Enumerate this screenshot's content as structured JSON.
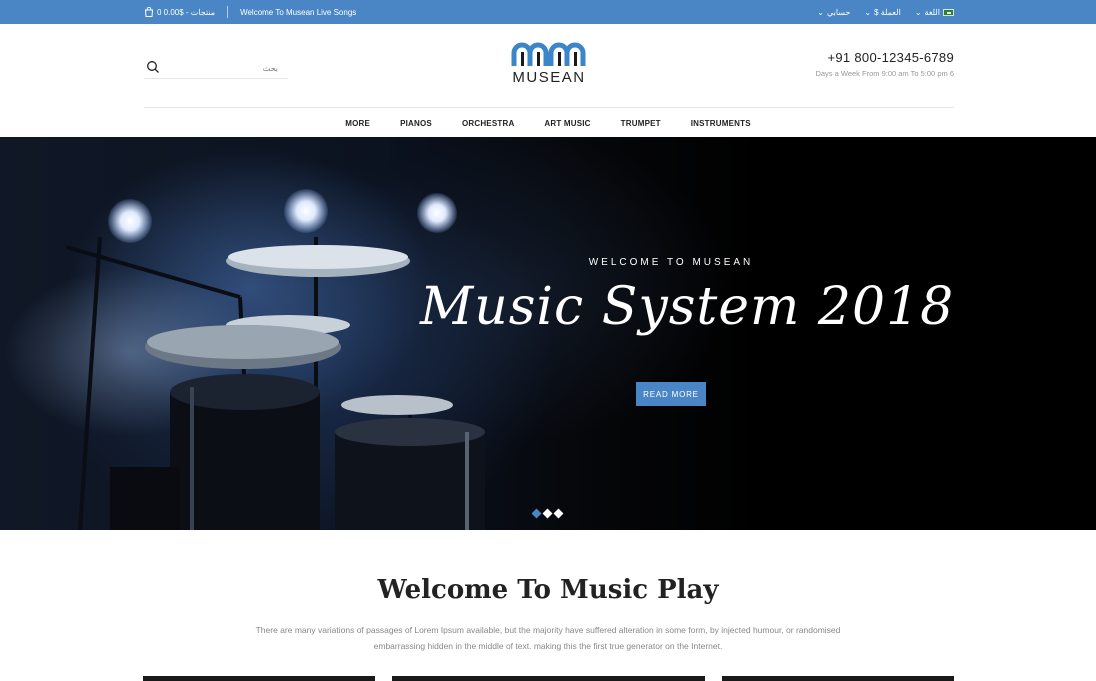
{
  "topbar": {
    "cart_text": "0 منتجات - $0.00",
    "welcome": "Welcome To Musean Live Songs",
    "account": "حسابي",
    "currency": "$ العملة",
    "language": "اللغة"
  },
  "header": {
    "search_placeholder": "بحث",
    "logo_text": "MUSEAN",
    "phone": "+91 800-12345-6789",
    "hours": "Days a Week From 9:00 am To 5:00 pm 6"
  },
  "nav": {
    "items": [
      "MORE",
      "PIANOS",
      "ORCHESTRA",
      "ART MUSIC",
      "TRUMPET",
      "INSTRUMENTS"
    ]
  },
  "hero": {
    "subtitle": "WELCOME TO MUSEAN",
    "title": "Music System 2018",
    "button": "READ MORE",
    "slides": 3,
    "active_slide": 1
  },
  "welcome": {
    "title": "Welcome To Music Play",
    "text": "There are many variations of passages of Lorem Ipsum available, but the majority have suffered alteration in some form, by injected humour, or randomised embarrassing hidden in the middle of text. making this the first true generator on the Internet."
  },
  "colors": {
    "accent": "#4a86c5",
    "text": "#222222",
    "muted": "#888888"
  }
}
